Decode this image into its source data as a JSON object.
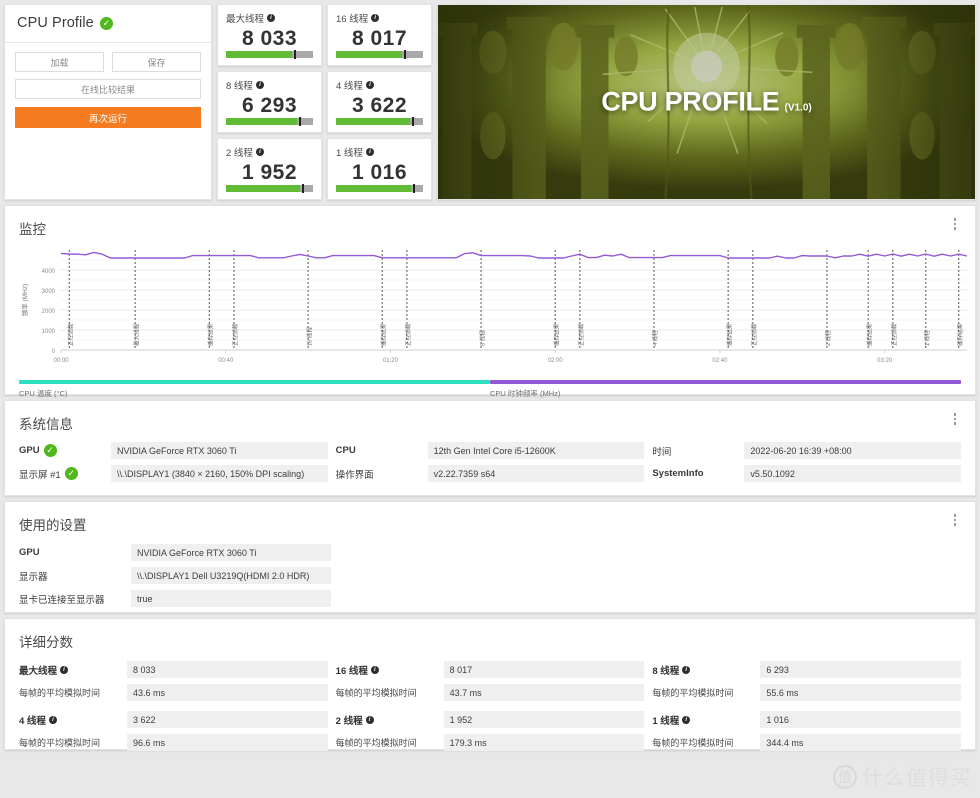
{
  "left_panel": {
    "title": "CPU Profile",
    "status_icon": "check-circle-icon",
    "buttons": {
      "load": "加载",
      "save": "保存",
      "compare_online": "在线比较结果",
      "run_again": "再次运行"
    },
    "accent_color": "#f47b20"
  },
  "scores": [
    {
      "label": "最大线程",
      "value": "8 033",
      "fill_pct": 76,
      "tick_pct": 78
    },
    {
      "label": "16 线程",
      "value": "8 017",
      "fill_pct": 76,
      "tick_pct": 78
    },
    {
      "label": "8 线程",
      "value": "6 293",
      "fill_pct": 82,
      "tick_pct": 84
    },
    {
      "label": "4 线程",
      "value": "3 622",
      "fill_pct": 85,
      "tick_pct": 87
    },
    {
      "label": "2 线程",
      "value": "1 952",
      "fill_pct": 85,
      "tick_pct": 87
    },
    {
      "label": "1 线程",
      "value": "1 016",
      "fill_pct": 86,
      "tick_pct": 88
    }
  ],
  "score_bar_colors": {
    "fill": "#62bb35",
    "track": "#a9a9a9",
    "tick": "#222222"
  },
  "hero": {
    "title": "CPU PROFILE",
    "version": "(V1.0)"
  },
  "monitor": {
    "title": "监控",
    "menu_icon": "kebab-menu-icon"
  },
  "chart_data": {
    "type": "line",
    "title": "监控",
    "xlabel": "",
    "ylabel": "频率 (MHz)",
    "ylim": [
      0,
      5000
    ],
    "yticks": [
      0,
      1000,
      2000,
      3000,
      4000
    ],
    "ytick_labels": [
      "0",
      "1000",
      "2000",
      "3000",
      "4000"
    ],
    "xlim": [
      0,
      220
    ],
    "xticks": [
      0,
      40,
      80,
      120,
      160,
      200
    ],
    "xtick_labels": [
      "00:00",
      "00:40",
      "01:20",
      "02:00",
      "02:40",
      "03:20"
    ],
    "grid": true,
    "legend_position": "bottom",
    "series": [
      {
        "name": "CPU 温度 (°C)",
        "color": "#2fe0c0",
        "visible_in_plot": false,
        "values": []
      },
      {
        "name": "CPU 时钟频率 (MHz)",
        "color": "#9259d6",
        "visible_in_plot": true,
        "x": [
          0,
          2,
          4,
          6,
          8,
          10,
          12,
          14,
          16,
          18,
          20,
          22,
          24,
          26,
          28,
          30,
          32,
          34,
          36,
          38,
          40,
          42,
          44,
          46,
          48,
          50,
          52,
          54,
          56,
          58,
          60,
          62,
          64,
          66,
          68,
          70,
          72,
          74,
          76,
          78,
          80,
          82,
          84,
          86,
          88,
          90,
          92,
          94,
          96,
          98,
          100,
          102,
          104,
          106,
          108,
          110,
          112,
          114,
          116,
          118,
          120,
          122,
          124,
          126,
          128,
          130,
          132,
          134,
          136,
          138,
          140,
          142,
          144,
          146,
          148,
          150,
          152,
          154,
          156,
          158,
          160,
          162,
          164,
          166,
          168,
          170,
          172,
          174,
          176,
          178,
          180,
          182,
          184,
          186,
          188,
          190,
          192,
          194,
          196,
          198,
          200,
          202,
          204,
          206,
          208,
          210,
          212,
          214,
          216,
          218,
          220
        ],
        "values": [
          4830,
          4800,
          4790,
          4760,
          4880,
          4790,
          4600,
          4600,
          4600,
          4600,
          4600,
          4600,
          4600,
          4600,
          4600,
          4600,
          4720,
          4720,
          4720,
          4720,
          4720,
          4720,
          4720,
          4720,
          4610,
          4610,
          4610,
          4610,
          4700,
          4780,
          4700,
          4610,
          4610,
          4720,
          4720,
          4720,
          4720,
          4720,
          4720,
          4610,
          4610,
          4610,
          4610,
          4610,
          4610,
          4610,
          4610,
          4610,
          4610,
          4820,
          4860,
          4720,
          4720,
          4720,
          4720,
          4720,
          4720,
          4700,
          4600,
          4600,
          4600,
          4600,
          4700,
          4790,
          4620,
          4620,
          4740,
          4700,
          4790,
          4620,
          4620,
          4620,
          4620,
          4620,
          4720,
          4720,
          4720,
          4720,
          4720,
          4720,
          4720,
          4600,
          4600,
          4600,
          4600,
          4600,
          4600,
          4690,
          4600,
          4600,
          4720,
          4700,
          4700,
          4700,
          4610,
          4700,
          4700,
          4790,
          4690,
          4790,
          4700,
          4800,
          4690,
          4790,
          4700,
          4800,
          4690,
          4790,
          4700,
          4790,
          4700
        ]
      }
    ],
    "event_markers": [
      {
        "x": 2,
        "label": "正在加载"
      },
      {
        "x": 18,
        "label": "最大线程"
      },
      {
        "x": 36,
        "label": "缓存结果"
      },
      {
        "x": 42,
        "label": "正在加载"
      },
      {
        "x": 60,
        "label": "16 线程"
      },
      {
        "x": 78,
        "label": "缓存结果"
      },
      {
        "x": 84,
        "label": "正在加载"
      },
      {
        "x": 102,
        "label": "8 线程"
      },
      {
        "x": 120,
        "label": "缓存结果"
      },
      {
        "x": 126,
        "label": "正在加载"
      },
      {
        "x": 144,
        "label": "4 线程"
      },
      {
        "x": 162,
        "label": "缓存结果"
      },
      {
        "x": 168,
        "label": "正在加载"
      },
      {
        "x": 186,
        "label": "2 线程"
      },
      {
        "x": 196,
        "label": "缓存结果"
      },
      {
        "x": 202,
        "label": "正在加载"
      },
      {
        "x": 210,
        "label": "1 线程"
      },
      {
        "x": 218,
        "label": "缓存结果"
      }
    ]
  },
  "system_info": {
    "title": "系统信息",
    "menu_icon": "kebab-menu-icon",
    "columns": [
      [
        {
          "key": "GPU",
          "value": "NVIDIA GeForce RTX 3060 Ti",
          "bold": true,
          "check": true
        },
        {
          "key": "显示屏 #1",
          "value": "\\\\.\\DISPLAY1 (3840 × 2160, 150% DPI scaling)",
          "bold": false,
          "check": true
        }
      ],
      [
        {
          "key": "CPU",
          "value": "12th Gen Intel Core i5-12600K",
          "bold": true,
          "check": false
        },
        {
          "key": "操作界面",
          "value": "v2.22.7359 s64",
          "bold": false,
          "check": false
        }
      ],
      [
        {
          "key": "时间",
          "value": "2022-06-20 16:39 +08:00",
          "bold": false,
          "check": false
        },
        {
          "key": "SystemInfo",
          "value": "v5.50.1092",
          "bold": true,
          "check": false
        }
      ]
    ]
  },
  "used_settings": {
    "title": "使用的设置",
    "menu_icon": "kebab-menu-icon",
    "rows": [
      {
        "key": "GPU",
        "value": "NVIDIA GeForce RTX 3060 Ti",
        "bold": true
      },
      {
        "key": "显示器",
        "value": "\\\\.\\DISPLAY1 Dell U3219Q(HDMI 2.0 HDR)",
        "bold": false
      },
      {
        "key": "显卡已连接至显示器",
        "value": "true",
        "bold": false
      }
    ]
  },
  "detailed_scores": {
    "title": "详细分数",
    "frame_time_label": "每帧的平均模拟时间",
    "entries": [
      {
        "label": "最大线程",
        "score": "8 033",
        "frame_time": "43.6 ms"
      },
      {
        "label": "16 线程",
        "score": "8 017",
        "frame_time": "43.7 ms"
      },
      {
        "label": "8 线程",
        "score": "6 293",
        "frame_time": "55.6 ms"
      },
      {
        "label": "4 线程",
        "score": "3 622",
        "frame_time": "96.6 ms"
      },
      {
        "label": "2 线程",
        "score": "1 952",
        "frame_time": "179.3 ms"
      },
      {
        "label": "1 线程",
        "score": "1 016",
        "frame_time": "344.4 ms"
      }
    ]
  },
  "watermark": {
    "mark": "值",
    "text": "什么值得买"
  }
}
